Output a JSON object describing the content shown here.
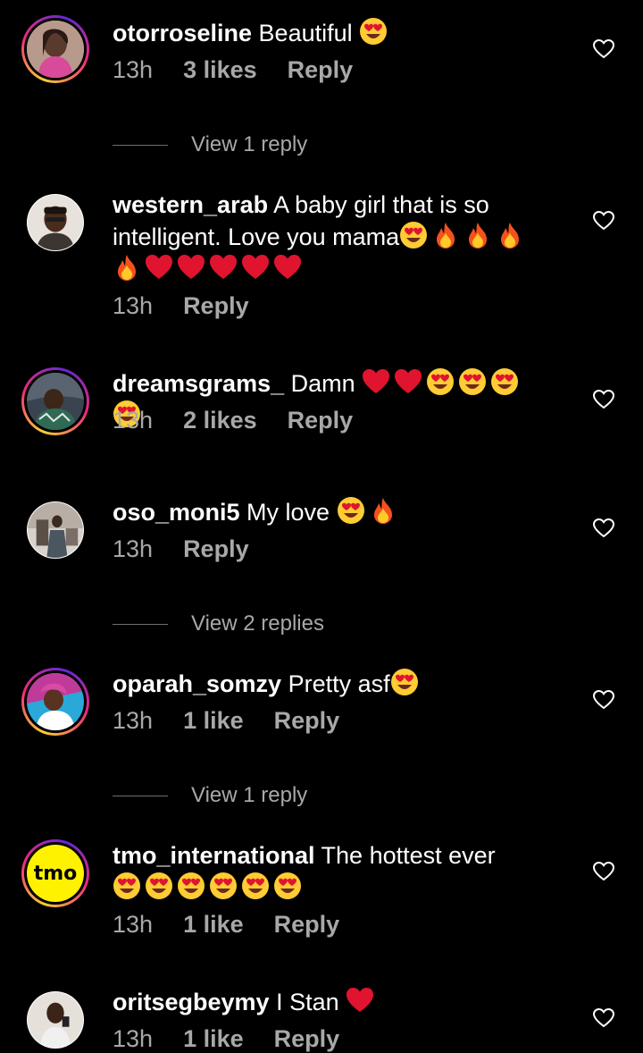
{
  "colors": {
    "background": "#000000",
    "text": "#ffffff",
    "muted": "#a8a8a8",
    "heart_emoji": "#e0142f",
    "story_ring": [
      "#f9ce34",
      "#ee2a7b",
      "#6228d7"
    ]
  },
  "comments": [
    {
      "username": "otorroseline",
      "text": "Beautiful",
      "emojis": [
        "heart-eyes"
      ],
      "time": "13h",
      "likes": "3 likes",
      "reply_label": "Reply",
      "view_replies": "View 1 reply"
    },
    {
      "username": "western_arab",
      "text": "A baby girl that is so intelligent. Love you mama",
      "emojis": [
        "heart-eyes",
        "fire",
        "fire",
        "fire",
        "fire",
        "red-heart",
        "red-heart",
        "red-heart",
        "red-heart",
        "red-heart"
      ],
      "time": "13h",
      "likes": "",
      "reply_label": "Reply"
    },
    {
      "username": "dreamsgrams_",
      "text": "Damn",
      "emojis": [
        "red-heart",
        "red-heart",
        "heart-eyes",
        "heart-eyes",
        "heart-eyes",
        "heart-eyes"
      ],
      "time": "13h",
      "likes": "2 likes",
      "reply_label": "Reply"
    },
    {
      "username": "oso_moni5",
      "text": "My love",
      "emojis": [
        "heart-eyes",
        "fire"
      ],
      "time": "13h",
      "likes": "",
      "reply_label": "Reply",
      "view_replies": "View 2 replies"
    },
    {
      "username": "oparah_somzy",
      "text": "Pretty asf",
      "emojis": [
        "heart-eyes"
      ],
      "time": "13h",
      "likes": "1 like",
      "reply_label": "Reply",
      "view_replies": "View 1 reply"
    },
    {
      "username": "tmo_international",
      "text": "The hottest ever",
      "emojis": [
        "heart-eyes",
        "heart-eyes",
        "heart-eyes",
        "heart-eyes",
        "heart-eyes",
        "heart-eyes"
      ],
      "time": "13h",
      "likes": "1 like",
      "reply_label": "Reply",
      "avatar_logo_text": "tmo"
    },
    {
      "username": "oritsegbeymy",
      "text": "I Stan",
      "emojis": [
        "red-heart"
      ],
      "time": "13h",
      "likes": "1 like",
      "reply_label": "Reply"
    }
  ]
}
